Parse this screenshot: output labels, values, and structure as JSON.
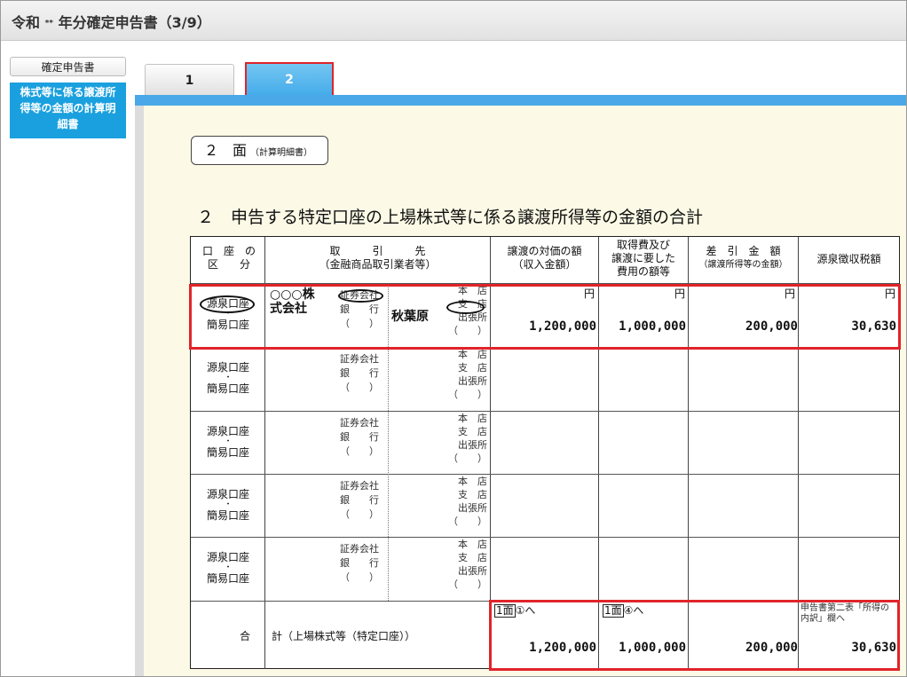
{
  "window": {
    "title_prefix": "令和",
    "era_mark": "**",
    "title_suffix": "年分確定申告書（3/9）"
  },
  "sidebar": {
    "items": [
      {
        "label": "確定申告書"
      },
      {
        "label_lines": [
          "株式等に係る譲渡所",
          "得等の金額の計算明",
          "細書"
        ]
      }
    ]
  },
  "tabs": [
    {
      "label": "1"
    },
    {
      "label": "2"
    }
  ],
  "page": {
    "men_label": "２　面",
    "men_sub": "（計算明細書）",
    "heading": "２　申告する特定口座の上場株式等に係る譲渡所得等の金額の合計"
  },
  "table": {
    "headers": {
      "col1": [
        "口　座　の",
        "区　　分"
      ],
      "col2": [
        "取　　　引　　　先",
        "（金融商品取引業者等）"
      ],
      "col3": [
        "譲渡の対価の額",
        "（収入金額）"
      ],
      "col4": [
        "取得費及び",
        "譲渡に要した",
        "費用の額等"
      ],
      "col5": [
        "差　引　金　額",
        "（譲渡所得等の金額）"
      ],
      "col6": [
        "源泉徴収税額"
      ]
    },
    "unit": "円",
    "account_types": [
      "源泉口座",
      "・",
      "簡易口座"
    ],
    "institution_types": [
      "証券会社",
      "銀　　行",
      "（　　）"
    ],
    "branch_types": [
      "本　店",
      "支　店",
      "出張所",
      "（　　）"
    ],
    "row1": {
      "company": [
        "○○○株",
        "式会社"
      ],
      "branch_name": "秋葉原",
      "revenue": "1,200,000",
      "cost": "1,000,000",
      "diff": "200,000",
      "tax": "30,630"
    },
    "total": {
      "label": "合　　計（上場株式等（特定口座））",
      "ref1_box": "1面",
      "ref1_text": "①へ",
      "ref2_box": "1面",
      "ref2_text": "④へ",
      "ref4": "申告書第二表「所得の内訳」欄へ",
      "revenue": "1,200,000",
      "cost": "1,000,000",
      "diff": "200,000",
      "tax": "30,630"
    }
  }
}
